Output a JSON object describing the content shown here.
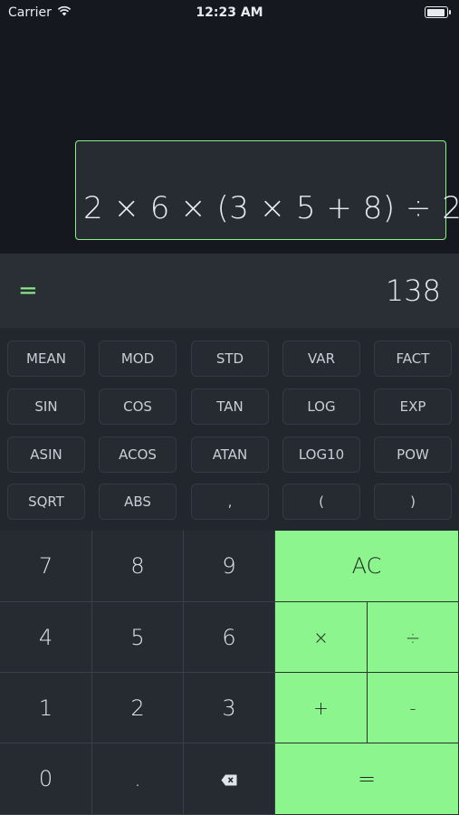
{
  "status_bar": {
    "carrier": "Carrier",
    "time": "12:23 AM",
    "wifi_icon": "wifi-icon",
    "battery_icon": "battery-icon"
  },
  "expression": {
    "text": "2 × 6 × (3 × 5  + 8) ÷ 2"
  },
  "result": {
    "equals": "=",
    "value": "138"
  },
  "functions": [
    [
      "MEAN",
      "MOD",
      "STD",
      "VAR",
      "FACT"
    ],
    [
      "SIN",
      "COS",
      "TAN",
      "LOG",
      "EXP"
    ],
    [
      "ASIN",
      "ACOS",
      "ATAN",
      "LOG10",
      "POW"
    ],
    [
      "SQRT",
      "ABS",
      ",",
      "(",
      ")"
    ]
  ],
  "keypad": {
    "digits": {
      "seven": "7",
      "eight": "8",
      "nine": "9",
      "four": "4",
      "five": "5",
      "six": "6",
      "one": "1",
      "two": "2",
      "three": "3",
      "zero": "0",
      "dot": "."
    },
    "backspace_icon": "backspace-icon",
    "ops": {
      "ac": "AC",
      "multiply": "×",
      "divide": "÷",
      "plus": "+",
      "minus": "-",
      "equals": "="
    }
  },
  "colors": {
    "accent": "#8cf58e",
    "background": "#15191f",
    "keypad": "#262b32"
  }
}
